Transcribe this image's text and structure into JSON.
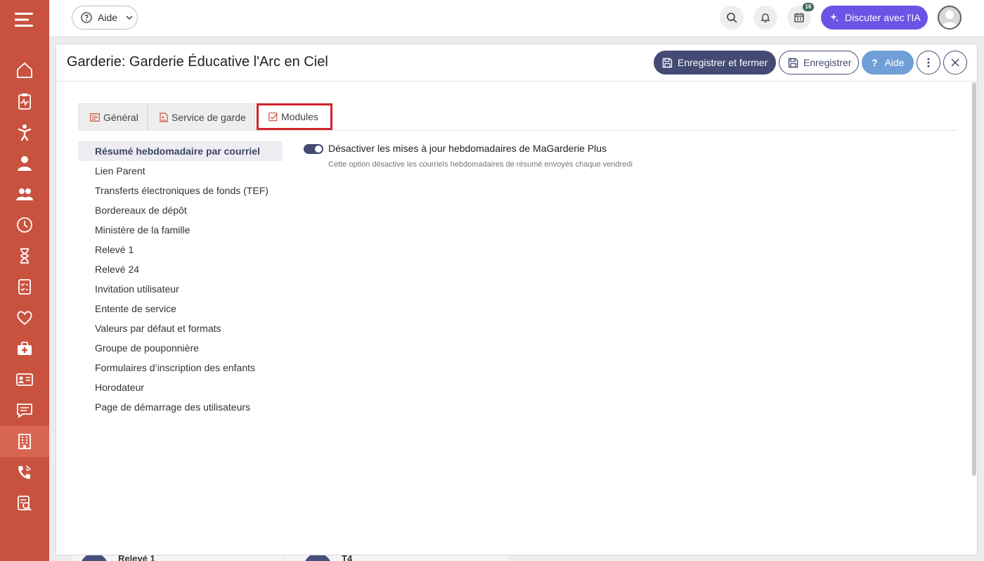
{
  "topbar": {
    "help_label": "Aide",
    "notification_badge": "16",
    "ai_button_label": "Discuter avec l'IA"
  },
  "modal": {
    "title": "Garderie: Garderie Éducative l'Arc en Ciel",
    "save_close_label": "Enregistrer et fermer",
    "save_label": "Enregistrer",
    "help_label": "Aide"
  },
  "tabs": [
    {
      "label": "Général"
    },
    {
      "label": "Service de garde"
    },
    {
      "label": "Modules"
    }
  ],
  "side_list": [
    {
      "label": "Résumé hebdomadaire par courriel"
    },
    {
      "label": "Lien Parent"
    },
    {
      "label": "Transferts électroniques de fonds (TEF)"
    },
    {
      "label": "Bordereaux de dépôt"
    },
    {
      "label": "Ministère de la famille"
    },
    {
      "label": "Relevé 1"
    },
    {
      "label": "Relevé 24"
    },
    {
      "label": "Invitation utilisateur"
    },
    {
      "label": "Entente de service"
    },
    {
      "label": "Valeurs par défaut et formats"
    },
    {
      "label": "Groupe de pouponnière"
    },
    {
      "label": "Formulaires d’inscription des enfants"
    },
    {
      "label": "Horodateur"
    },
    {
      "label": "Page de démarrage des utilisateurs"
    }
  ],
  "content": {
    "toggle_on": true,
    "option_label": "Désactiver les mises à jour hebdomadaires de MaGarderie Plus",
    "option_description": "Cette option désactive les courriels hebdomadaires de résumé envoyés chaque vendredi"
  },
  "background_cards": [
    {
      "label": "Relevé 1"
    },
    {
      "label": "T4"
    }
  ],
  "colors": {
    "sidebar": "#c9523f",
    "primary": "#434a73",
    "ai": "#6c53e6",
    "help": "#6f9fd6",
    "highlight": "#d2232a"
  }
}
